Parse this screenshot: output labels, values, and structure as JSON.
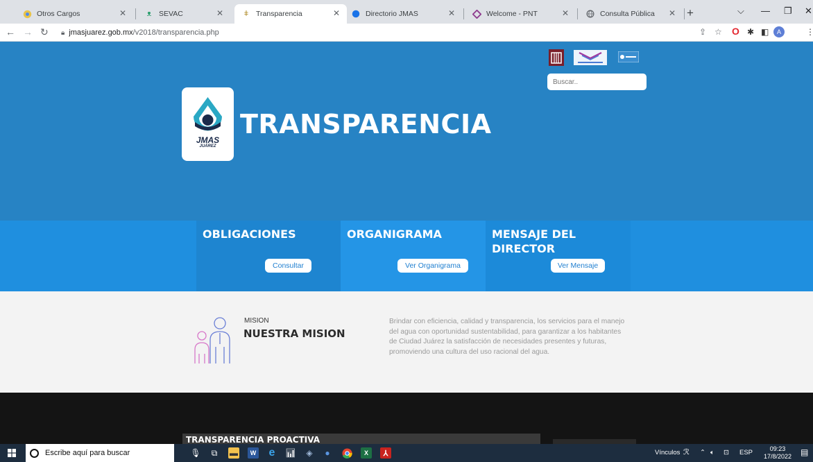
{
  "browser": {
    "tabs": [
      {
        "label": "Otros Cargos",
        "icon": "chrome-icon"
      },
      {
        "label": "SEVAC",
        "icon": "sevac-icon"
      },
      {
        "label": "Transparencia",
        "icon": "transparencia-icon"
      },
      {
        "label": "Directorio JMAS",
        "icon": "globe-icon"
      },
      {
        "label": "Welcome - PNT",
        "icon": "pnt-icon"
      },
      {
        "label": "Consulta Pública",
        "icon": "globe-icon"
      }
    ],
    "active_tab": 2,
    "url_host": "jmasjuarez.gob.mx",
    "url_path": "/v2018/transparencia.php",
    "profile_initial": "A"
  },
  "hero": {
    "title": "TRANSPARENCIA",
    "logo_text": "JMAS",
    "logo_subtext": "JUÁREZ",
    "search_placeholder": "Buscar.."
  },
  "cards": [
    {
      "title": "OBLIGACIONES",
      "button": "Consultar"
    },
    {
      "title": "ORGANIGRAMA",
      "button": "Ver Organigrama"
    },
    {
      "title": "MENSAJE DEL DIRECTOR",
      "button": "Ver Mensaje"
    }
  ],
  "mission": {
    "small_label": "MISION",
    "title": "NUESTRA MISION",
    "text": "Brindar con eficiencia, calidad y transparencia, los servicios para el manejo del agua con oportunidad sustentabilidad, para garantizar a los habitantes de Ciudad Juárez la satisfacción de necesidades presentes y futuras, promoviendo una cultura del uso racional del agua."
  },
  "dark_section": {
    "title": "TRANSPARENCIA PROACTIVA"
  },
  "taskbar": {
    "search_placeholder": "Escribe aquí para buscar",
    "links_label": "Vínculos",
    "language": "ESP",
    "time": "09:23",
    "date": "17/8/2022"
  },
  "colors": {
    "hero_bg": "#2783c4",
    "band_bg": "#1f8fdf",
    "card_left": "#1e85d0",
    "card_mid": "#2495e6",
    "card_right": "#1c8ad9"
  }
}
